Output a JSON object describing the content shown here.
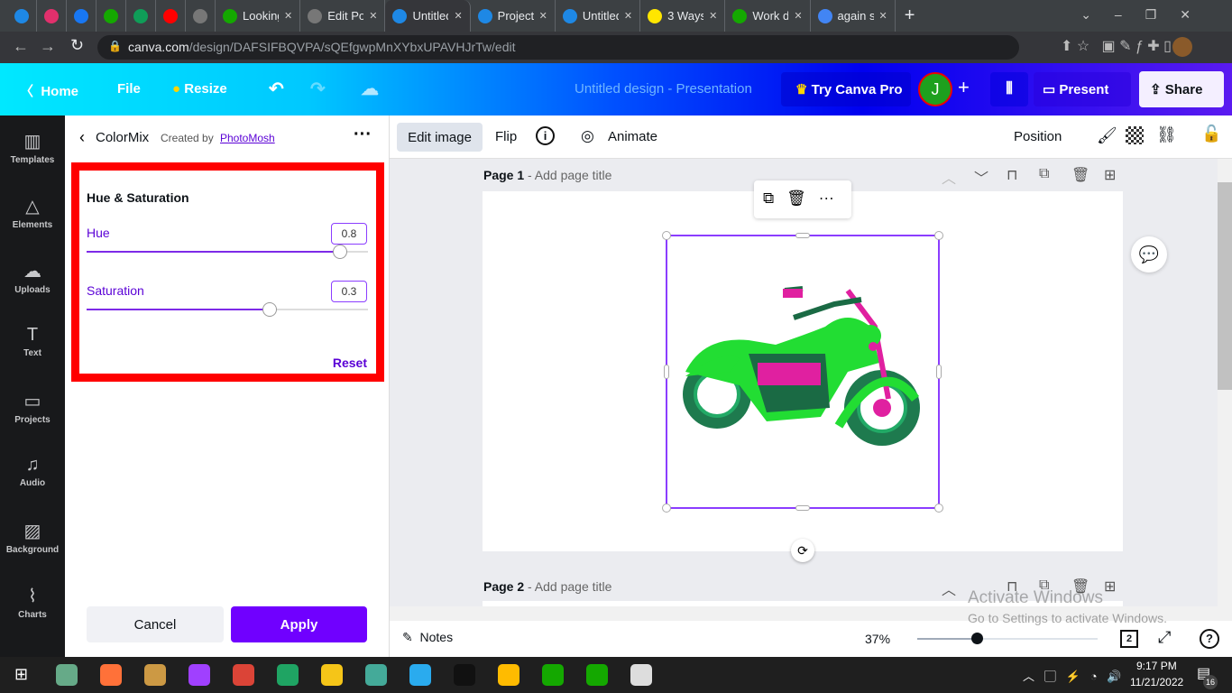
{
  "browser": {
    "tabs": [
      {
        "title": "",
        "color": "#1e88e5"
      },
      {
        "title": "",
        "color": "#e1306c"
      },
      {
        "title": "",
        "color": "#1877f2"
      },
      {
        "title": "",
        "color": "#14a800"
      },
      {
        "title": "",
        "color": "#0f9d58"
      },
      {
        "title": "",
        "color": "#ff0000"
      },
      {
        "title": "",
        "color": "#777"
      },
      {
        "title": "Looking",
        "color": "#14a800"
      },
      {
        "title": "Edit Po",
        "color": "#777"
      },
      {
        "title": "Untitled",
        "color": "#1e88e5",
        "active": true
      },
      {
        "title": "Project",
        "color": "#1e88e5"
      },
      {
        "title": "Untitled",
        "color": "#1e88e5"
      },
      {
        "title": "3 Ways",
        "color": "#ffe600"
      },
      {
        "title": "Work d",
        "color": "#14a800"
      },
      {
        "title": "again s",
        "color": "#4285f4"
      }
    ],
    "url_domain": "canva.com",
    "url_path": "/design/DAFSIFBQVPA/sQEfgwpMnXYbxUPAVHJrTw/edit"
  },
  "header": {
    "home": "Home",
    "file": "File",
    "resize": "Resize",
    "title": "Untitled design - Presentation",
    "try_pro": "Try Canva Pro",
    "avatar": "J",
    "present": "Present",
    "share": "Share"
  },
  "rail": [
    {
      "label": "Templates",
      "icon": "▥"
    },
    {
      "label": "Elements",
      "icon": "△"
    },
    {
      "label": "Uploads",
      "icon": "☁"
    },
    {
      "label": "Text",
      "icon": "T"
    },
    {
      "label": "Projects",
      "icon": "▭"
    },
    {
      "label": "Audio",
      "icon": "♫"
    },
    {
      "label": "Background",
      "icon": "▨"
    },
    {
      "label": "Charts",
      "icon": "⌇"
    }
  ],
  "panel": {
    "app_name": "ColorMix",
    "created_by": "Created by",
    "author": "PhotoMosh",
    "section_title": "Hue & Saturation",
    "hue_label": "Hue",
    "hue_value": "0.8",
    "hue_fraction": 0.9,
    "sat_label": "Saturation",
    "sat_value": "0.3",
    "sat_fraction": 0.65,
    "reset": "Reset",
    "cancel": "Cancel",
    "apply": "Apply",
    "highlight_color": "#ff0000",
    "accent": "#7d2ae8"
  },
  "toolbar": {
    "edit_image": "Edit image",
    "flip": "Flip",
    "animate": "Animate",
    "position": "Position"
  },
  "pages": [
    {
      "label": "Page 1",
      "subtitle": "- Add page title"
    },
    {
      "label": "Page 2",
      "subtitle": "- Add page title"
    }
  ],
  "bottom": {
    "notes": "Notes",
    "zoom": "37%",
    "zoom_fraction": 0.33,
    "page_count": "2"
  },
  "watermark": {
    "line1": "Activate Windows",
    "line2": "Go to Settings to activate Windows."
  },
  "taskbar": {
    "time": "9:17 PM",
    "date": "11/21/2022",
    "notifications": "16"
  }
}
